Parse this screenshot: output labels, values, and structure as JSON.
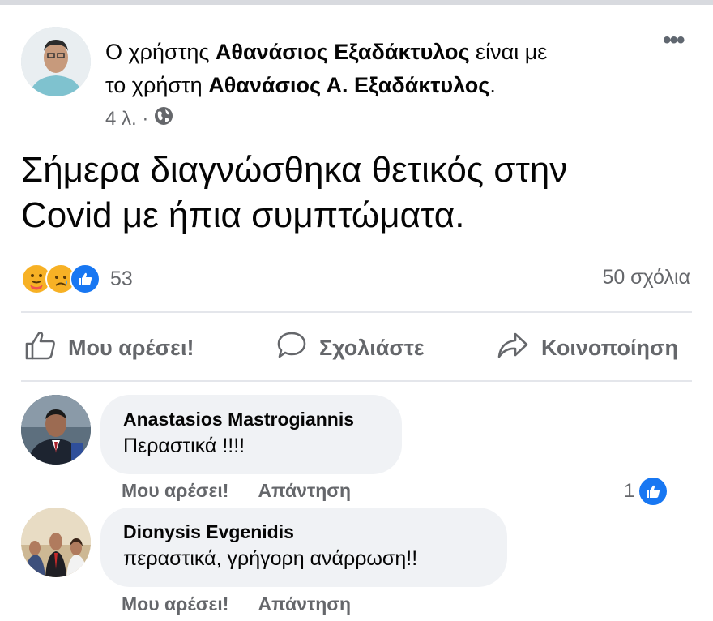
{
  "post": {
    "header_prefix": "Ο χρήστης ",
    "author": "Αθανάσιος Εξαδάκτυλος",
    "header_mid": " είναι με",
    "header_line2_prefix": "το χρήστη ",
    "tagged_user": "Αθανάσιος Α. Εξαδάκτυλος",
    "header_line2_suffix": ".",
    "time": "4 λ. ·",
    "privacy_icon": "globe-icon",
    "more_icon": "more-options-icon",
    "text_line1": "Σήμερα διαγνώσθηκα θετικός στην",
    "text_line2": "Covid με ήπια συμπτώματα.",
    "reaction_count": "53",
    "comments_count": "50 σχόλια",
    "reactions": [
      "care",
      "sad",
      "like"
    ]
  },
  "actions": {
    "like": "Μου αρέσει!",
    "comment": "Σχολιάστε",
    "share": "Κοινοποίηση"
  },
  "comments": [
    {
      "name": "Anastasios Mastrogiannis",
      "text": "Περαστικά !!!!",
      "like_label": "Μου αρέσει!",
      "reply_label": "Απάντηση",
      "likes": "1"
    },
    {
      "name": "Dionysis Evgenidis",
      "text": "περαστικά, γρήγορη ανάρρωση!!",
      "like_label": "Μου αρέσει!",
      "reply_label": "Απάντηση"
    }
  ],
  "colors": {
    "facebook_blue": "#1877f2",
    "secondary_text": "#65676b",
    "bubble_bg": "#f0f2f5"
  }
}
